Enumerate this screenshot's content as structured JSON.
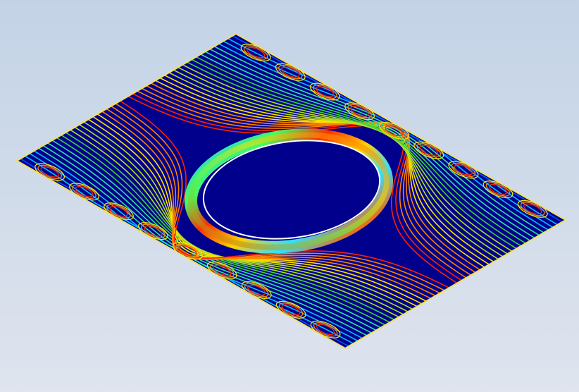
{
  "viewport": {
    "background_top": "#c3d3e6",
    "background_bottom": "#dfe4ee"
  },
  "plate": {
    "fill_color": "#00008c",
    "edge_color": "#f0e060",
    "hole_fill_color": "#00008c",
    "hole_rim_color": "#ffffff"
  },
  "contours": {
    "count": 48,
    "colormap": [
      "#0000b0",
      "#0050ff",
      "#00c0ff",
      "#30e0a0",
      "#40d040",
      "#b0e020",
      "#ffe000",
      "#ff8000",
      "#ff2000"
    ]
  }
}
